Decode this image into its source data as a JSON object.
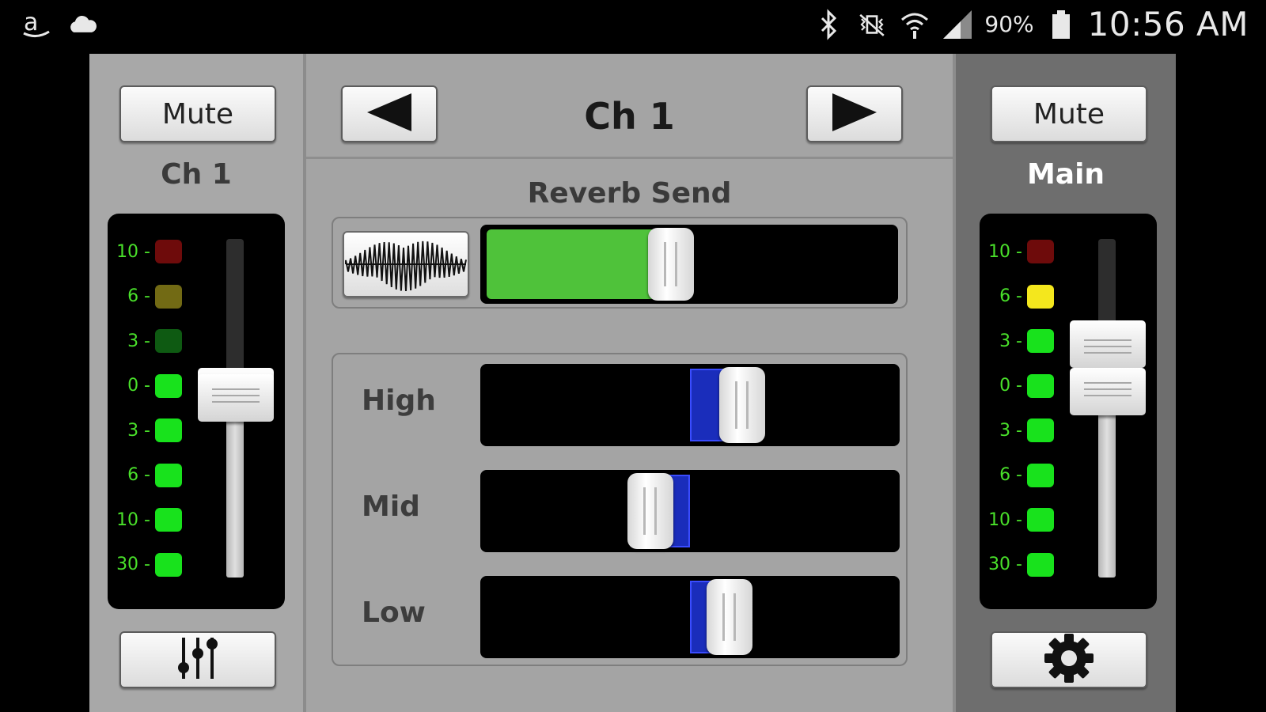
{
  "status_bar": {
    "left_icons": [
      "amazon-icon",
      "cloud-icon"
    ],
    "right_icons": [
      "bluetooth-icon",
      "vibrate-off-icon",
      "wifi-icon",
      "signal-icon",
      "battery-icon"
    ],
    "battery": "90%",
    "time": "10:56 AM"
  },
  "left_strip": {
    "mute_label": "Mute",
    "channel_label": "Ch 1",
    "meter_labels": [
      "10",
      "6",
      "3",
      "0",
      "3",
      "6",
      "10",
      "30"
    ],
    "led_colors": [
      "#6e0b0b",
      "#726a14",
      "#0e5a12",
      "#18e21c",
      "#18e21c",
      "#18e21c",
      "#18e21c",
      "#18e21c"
    ],
    "fader_level": 0.53,
    "meter_level": 0.55,
    "bottom_icon": "mixer-sliders-icon"
  },
  "center": {
    "prev_icon": "triangle-left-icon",
    "next_icon": "triangle-right-icon",
    "title": "Ch 1",
    "reverb_label": "Reverb Send",
    "reverb_icon": "waveform-icon",
    "reverb_level": 0.45,
    "reverb_color": "#4fc23a",
    "eq": [
      {
        "label": "High",
        "value": 0.29,
        "color": "#1a2dbb"
      },
      {
        "label": "Mid",
        "value": -0.22,
        "color": "#1a2dbb"
      },
      {
        "label": "Low",
        "value": 0.22,
        "color": "#1a2dbb"
      }
    ]
  },
  "right_strip": {
    "mute_label": "Mute",
    "channel_label": "Main",
    "meter_labels": [
      "10",
      "6",
      "3",
      "0",
      "3",
      "6",
      "10",
      "30"
    ],
    "led_colors": [
      "#6e0b0b",
      "#f4e71d",
      "#18e21c",
      "#18e21c",
      "#18e21c",
      "#18e21c",
      "#18e21c",
      "#18e21c"
    ],
    "fader_level": 0.55,
    "meter_level": 0.69,
    "bottom_icon": "gear-icon"
  }
}
